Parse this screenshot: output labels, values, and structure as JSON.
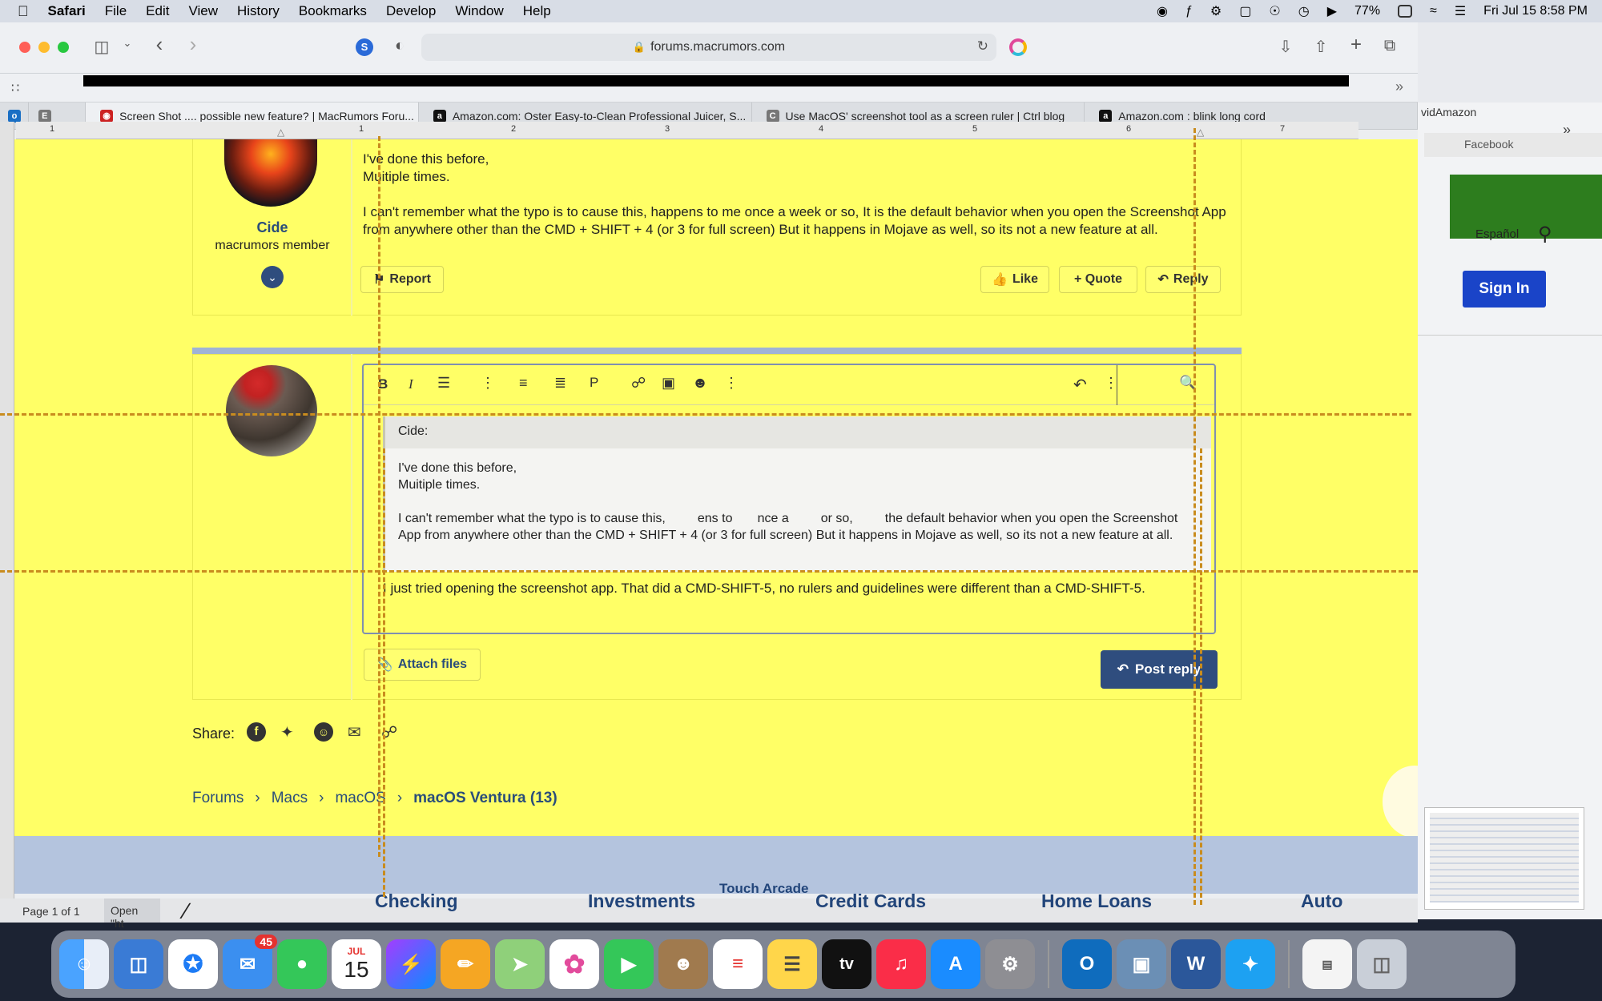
{
  "menubar": {
    "app": "Safari",
    "items": [
      "File",
      "Edit",
      "View",
      "History",
      "Bookmarks",
      "Develop",
      "Window",
      "Help"
    ],
    "battery": "77%",
    "datetime": "Fri Jul 15  8:58 PM"
  },
  "browser": {
    "url": "forums.macrumors.com",
    "tabs": [
      {
        "label": "Screen Shot .... possible new feature? | MacRumors Foru...",
        "icon": "macrumors-icon",
        "color": "#cc2222"
      },
      {
        "label": "Amazon.com: Oster Easy-to-Clean Professional Juicer, S...",
        "icon": "amazon-icon",
        "color": "#111111"
      },
      {
        "label": "Use MacOS' screenshot tool as a screen ruler | Ctrl blog",
        "icon": "ctrl-blog-icon",
        "color": "#777777"
      },
      {
        "label": "Amazon.com : blink long cord",
        "icon": "amazon-icon",
        "color": "#111111"
      }
    ],
    "extra_tab": "vidAmazon"
  },
  "ruler": {
    "numbers": [
      "1",
      "1",
      "2",
      "3",
      "4",
      "5",
      "6",
      "7"
    ]
  },
  "post": {
    "author": "Cide",
    "role": "macrumors member",
    "line1": "I've done this before,",
    "line2": "Muitiple times.",
    "para": "I can't remember what the typo is to cause this, happens to me once a week or so, It is the default behavior when you open the Screenshot App from anywhere other than the CMD + SHIFT + 4 (or 3 for full screen) But it happens in Mojave as well, so its not a new feature at all.",
    "report": "Report",
    "like": "Like",
    "quote": "+ Quote",
    "reply": "Reply"
  },
  "editor": {
    "quote_author": "Cide:",
    "quote_line1": "I've done this before,",
    "quote_line2": "Muitiple times.",
    "quote_para": "I can't remember what the typo is to cause this,         ens to       nce a         or so,         the default behavior when you open the Screenshot App from anywhere other than the CMD + SHIFT + 4 (or 3 for full screen) But it happens in Mojave as well, so its not a new feature at all.",
    "reply_text": "I just tried opening the screenshot app. That did a CMD-SHIFT-5, no rulers and guidelines were different than a CMD-SHIFT-5.",
    "attach": "Attach files",
    "post_reply": "Post reply"
  },
  "share": {
    "label": "Share:"
  },
  "breadcrumb": [
    "Forums",
    "Macs",
    "macOS",
    "macOS Ventura (13)"
  ],
  "bottom_links": [
    "Checking",
    "Investments",
    "Credit Cards",
    "Home Loans",
    "Auto"
  ],
  "touch_arcade": "Touch Arcade",
  "status": {
    "page": "Page 1 of 1",
    "open": "Open \"ht"
  },
  "side": {
    "facebook": "Facebook",
    "espanol": "Español",
    "signin": "Sign In"
  },
  "dock": {
    "mail_badge": "45",
    "cal_month": "JUL",
    "cal_day": "15",
    "tv": "tv"
  },
  "colors": {
    "page_bg": "#ffff66",
    "accent": "#2f4d7e",
    "guide": "#c98c1e"
  }
}
